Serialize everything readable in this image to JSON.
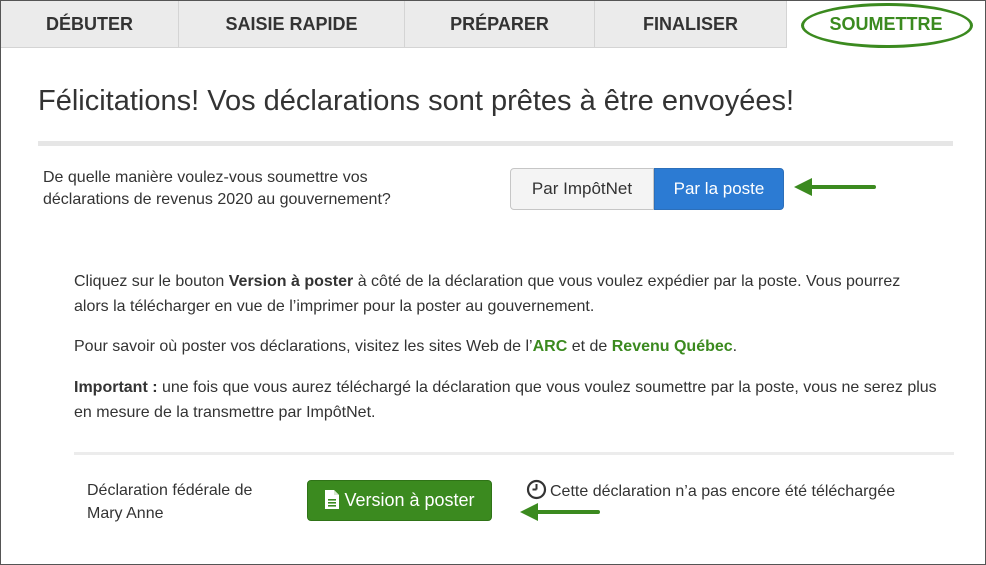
{
  "tabs": [
    {
      "label": "DÉBUTER"
    },
    {
      "label": "SAISIE RAPIDE"
    },
    {
      "label": "PRÉPARER"
    },
    {
      "label": "FINALISER"
    },
    {
      "label": "SOUMETTRE"
    }
  ],
  "active_tab": "SOUMETTRE",
  "title": "Félicitations! Vos déclarations sont prêtes à être envoyées!",
  "question": {
    "text": "De quelle manière voulez-vous soumettre vos déclarations de revenus 2020 au gouvernement?",
    "options": [
      {
        "label": "Par ImpôtNet",
        "selected": false
      },
      {
        "label": "Par la poste",
        "selected": true
      }
    ]
  },
  "instructions": {
    "p1_before": "Cliquez sur le bouton ",
    "p1_bold": "Version à poster",
    "p1_after": " à côté de la déclaration que vous voulez expédier par la poste. Vous pourrez alors la télécharger en vue de l’imprimer pour la poster au gouvernement.",
    "p2_before": "Pour savoir où poster vos déclarations, visitez les sites Web de l’",
    "p2_link1": "ARC",
    "p2_middle": " et de ",
    "p2_link2": "Revenu Québec",
    "p2_after": ".",
    "p3_bold": "Important :",
    "p3_after": " une fois que vous aurez téléchargé la déclaration que vous voulez soumettre par la poste, vous ne serez plus en mesure de la transmettre par ImpôtNet."
  },
  "declaration": {
    "label": "Déclaration fédérale de Mary Anne",
    "button_label": "Version à poster",
    "button_icon": "document-icon",
    "status_icon": "clock-icon",
    "status_text": "Cette déclaration n’a pas encore été téléchargée"
  },
  "colors": {
    "accent_green": "#3b8a1f",
    "selected_blue": "#2c7bd3",
    "tab_bg": "#ebebeb"
  }
}
